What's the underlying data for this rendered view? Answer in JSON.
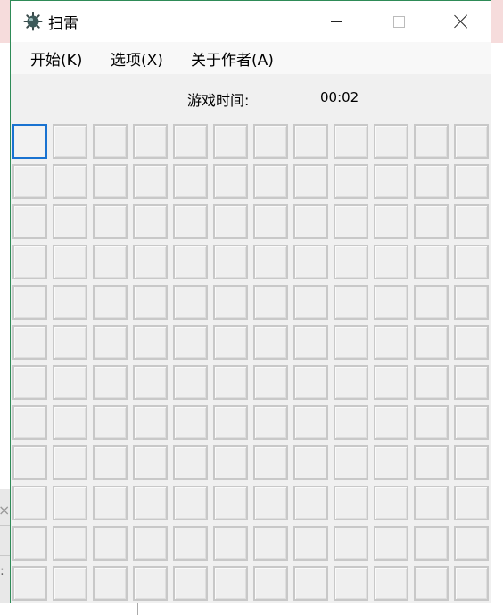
{
  "window": {
    "title": "扫雷",
    "app_icon": "mine-icon"
  },
  "controls": {
    "minimize_icon": "minimize-icon",
    "maximize_icon": "maximize-icon",
    "close_icon": "close-icon"
  },
  "menu": {
    "items": [
      {
        "label": "开始(K)"
      },
      {
        "label": "选项(X)"
      },
      {
        "label": "关于作者(A)"
      }
    ]
  },
  "timer": {
    "label": "游戏时间:",
    "value": "00:02"
  },
  "board": {
    "rows": 12,
    "cols": 12,
    "focused_cell": {
      "row": 1,
      "col": 1
    }
  },
  "background": {
    "fragment_glyph": "×",
    "fragment_text": ":"
  }
}
